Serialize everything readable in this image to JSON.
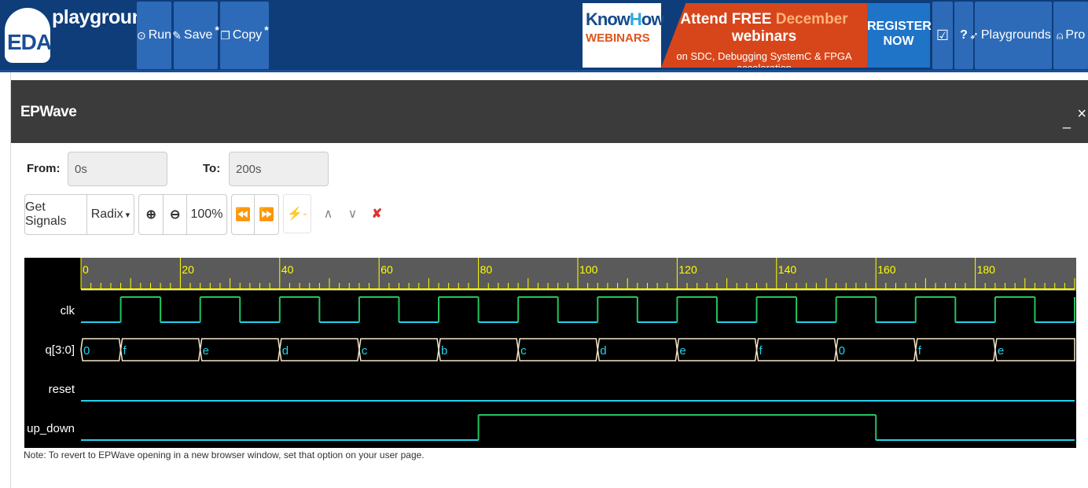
{
  "navbar": {
    "logo_mark": "EDA",
    "logo_text": "playground",
    "run_label": "Run",
    "save_label": "Save",
    "save_star": "*",
    "copy_label": "Copy",
    "copy_star": "*",
    "playgrounds_label": "Playgrounds",
    "profile_label": "Pro"
  },
  "banner": {
    "brand_1": "Know",
    "brand_o": "H",
    "brand_2": "ow",
    "brand_sub": "WEBINARS",
    "headline_a": "Attend FREE",
    "headline_dec": "December",
    "headline_b": "webinars",
    "subline": "on SDC, Debugging SystemC & FPGA acceleration",
    "register_1": "REGISTER",
    "register_2": "NOW"
  },
  "epwave": {
    "title": "EPWave",
    "minimize": "_",
    "close": "×",
    "from_label": "From:",
    "from_value": "0s",
    "to_label": "To:",
    "to_value": "200s",
    "toolbar": {
      "get_signals": "Get Signals",
      "radix": "Radix",
      "zoom_level": "100%"
    },
    "note": "Note: To revert to EPWave opening in a new browser window, set that option on your user page."
  },
  "waveform": {
    "time_range": [
      0,
      200
    ],
    "major_ticks": [
      0,
      20,
      40,
      60,
      80,
      100,
      120,
      140,
      160,
      180
    ],
    "signals": [
      {
        "name": "clk",
        "type": "clock",
        "period": 16,
        "first_rise": 8,
        "color": "#22c55e"
      },
      {
        "name": "q[3:0]",
        "type": "bus",
        "values": [
          {
            "t": 0,
            "v": "0"
          },
          {
            "t": 8,
            "v": "f"
          },
          {
            "t": 24,
            "v": "e"
          },
          {
            "t": 40,
            "v": "d"
          },
          {
            "t": 56,
            "v": "c"
          },
          {
            "t": 72,
            "v": "b"
          },
          {
            "t": 88,
            "v": "c"
          },
          {
            "t": 104,
            "v": "d"
          },
          {
            "t": 120,
            "v": "e"
          },
          {
            "t": 136,
            "v": "f"
          },
          {
            "t": 152,
            "v": "0"
          },
          {
            "t": 168,
            "v": "f"
          },
          {
            "t": 184,
            "v": "e"
          }
        ]
      },
      {
        "name": "reset",
        "type": "bit",
        "transitions": [
          {
            "t": 0,
            "v": 0
          }
        ],
        "color": "#22d3ee"
      },
      {
        "name": "up_down",
        "type": "bit",
        "transitions": [
          {
            "t": 0,
            "v": 0
          },
          {
            "t": 80,
            "v": 1
          },
          {
            "t": 160,
            "v": 0
          }
        ]
      }
    ],
    "colors": {
      "background": "#000000",
      "header_bg": "#5a5a5a",
      "ruler": "#ffff00",
      "low": "#22d3ee",
      "high": "#22c55e",
      "bus_line": "#f5e6c8",
      "bus_text": "#22d3ee"
    }
  }
}
